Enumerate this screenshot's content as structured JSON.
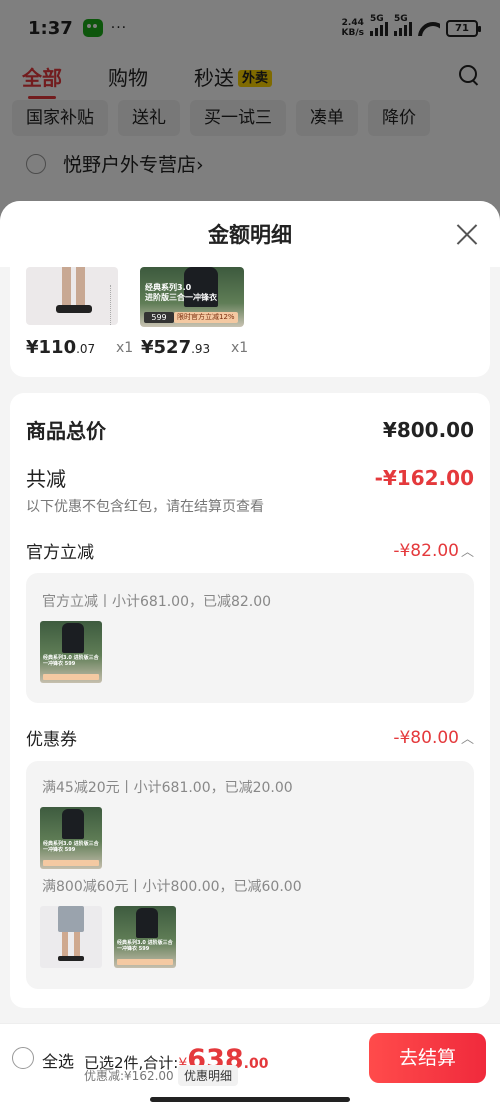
{
  "status": {
    "time": "1:37",
    "more": "···",
    "speed_top": "2.44",
    "speed_unit": "KB/s",
    "net1": "5G",
    "net2": "5G",
    "battery": "71"
  },
  "tabs": [
    {
      "label": "全部"
    },
    {
      "label": "购物"
    },
    {
      "label": "秒送",
      "badge": "外卖"
    }
  ],
  "filters": [
    "国家补贴",
    "送礼",
    "买一试三",
    "凑单",
    "降价"
  ],
  "store": {
    "name": "悦野户外专营店",
    "arrow": "›"
  },
  "sheet": {
    "title": "金额明细",
    "products": [
      {
        "price_int": "¥110",
        "price_dec": ".07",
        "qty": "x1"
      },
      {
        "price_int": "¥527",
        "price_dec": ".93",
        "qty": "x1",
        "promo_line1": "经典系列3.0",
        "promo_line2": "进阶版三合一冲锋衣",
        "tag_price": "599",
        "promo_band": "限时官方立减12%"
      }
    ],
    "total_label": "商品总价",
    "total_value": "¥800.00",
    "reduce_label": "共减",
    "reduce_value": "-¥162.00",
    "reduce_note": "以下优惠不包含红包，请在结算页查看",
    "official": {
      "label": "官方立减",
      "value": "-¥82.00",
      "detail": "官方立减丨小计681.00，已减82.00"
    },
    "coupon": {
      "label": "优惠券",
      "value": "-¥80.00",
      "line1": "满45减20元丨小计681.00，已减20.00",
      "line2": "满800减60元丨小计800.00，已减60.00"
    },
    "mini_text": "经典系列3.0 进阶版三合一冲锋衣 599"
  },
  "bottom": {
    "select_all": "全选",
    "summary_prefix": "已选2件,合计:",
    "currency": "¥",
    "amount_int": "638",
    "amount_dec": ".00",
    "discount": "优惠减:¥162.00",
    "detail_label": "优惠明细",
    "checkout_label": "去结算"
  },
  "colors": {
    "accent": "#e4393c",
    "badge": "#ffd400"
  }
}
